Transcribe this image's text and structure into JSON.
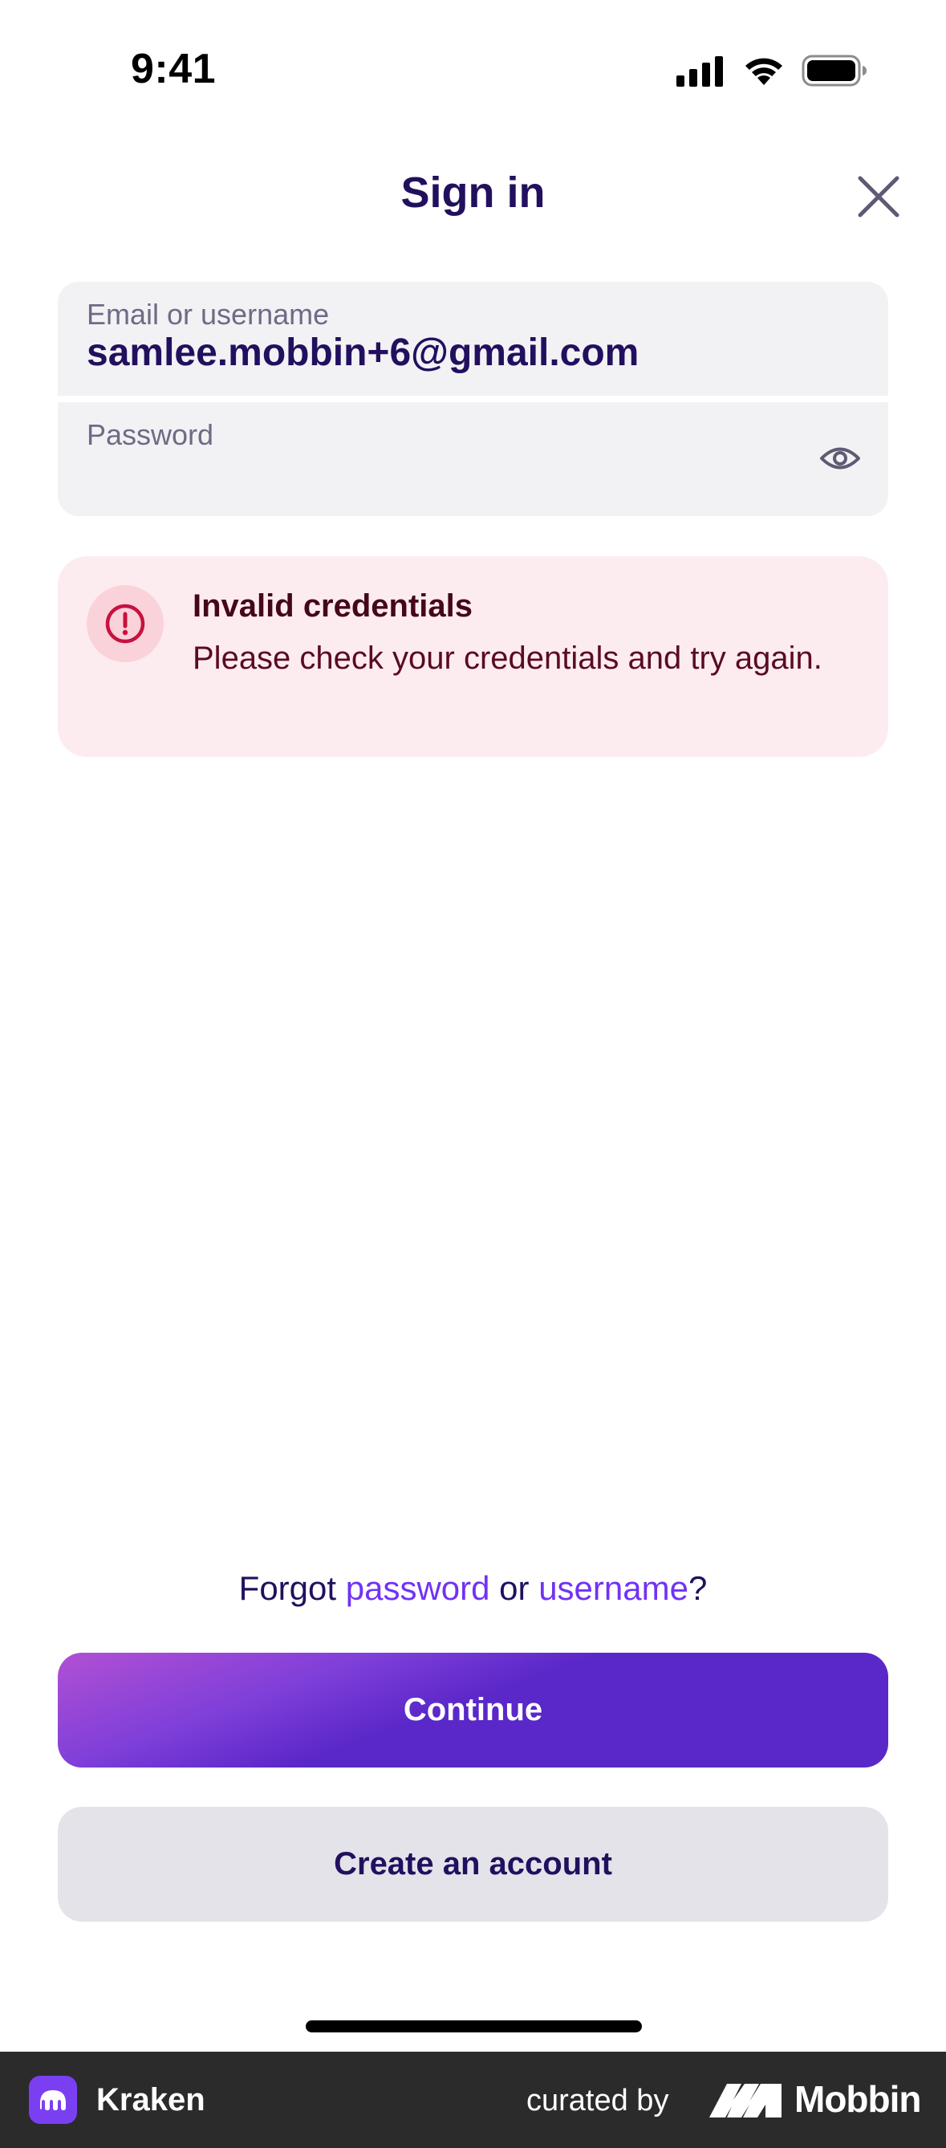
{
  "status_bar": {
    "time": "9:41"
  },
  "header": {
    "title": "Sign in"
  },
  "form": {
    "email_label": "Email or username",
    "email_value": "samlee.mobbin+6@gmail.com",
    "password_label": "Password",
    "password_value": ""
  },
  "alert": {
    "title": "Invalid credentials",
    "message": "Please check your credentials and try again."
  },
  "forgot": {
    "prefix": "Forgot ",
    "password_link": "password",
    "or": " or ",
    "username_link": "username",
    "suffix": "?"
  },
  "buttons": {
    "continue_label": "Continue",
    "create_account_label": "Create an account"
  },
  "footer": {
    "app_name": "Kraken",
    "curated_by": "curated by",
    "brand": "Mobbin"
  },
  "colors": {
    "accent": "#7132f5",
    "title": "#22105e",
    "alert_bg": "#fdecef",
    "alert_icon": "#c8113f"
  },
  "icons": {
    "close": "close-icon",
    "eye": "eye-icon",
    "alert": "exclamation-circle-icon"
  }
}
